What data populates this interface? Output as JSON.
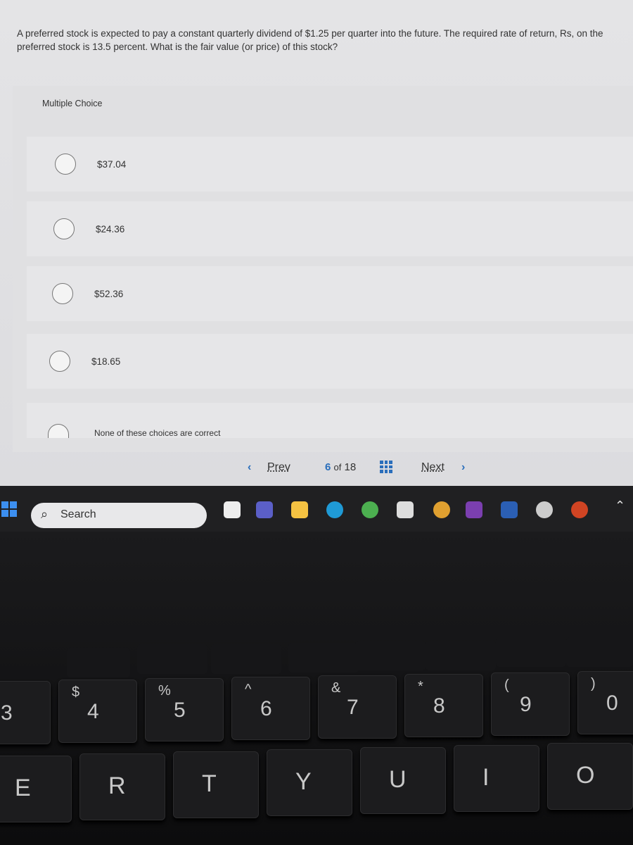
{
  "question": "A preferred stock is expected to pay a constant quarterly dividend of $1.25 per quarter into the future. The required rate of return, Rs, on the preferred stock is 13.5 percent. What is the fair value (or price) of this stock?",
  "multiple_choice_label": "Multiple Choice",
  "options": [
    "$37.04",
    "$24.36",
    "$52.36",
    "$18.65",
    "None of these choices are correct"
  ],
  "nav": {
    "prev": "Prev",
    "current": "6",
    "of": "of",
    "total": "18",
    "next": "Next"
  },
  "taskbar": {
    "search": "Search"
  },
  "accent": "#2a6ebb",
  "keyboard": {
    "num": [
      {
        "s": "",
        "m": "3"
      },
      {
        "s": "$",
        "m": "4"
      },
      {
        "s": "%",
        "m": "5"
      },
      {
        "s": "^",
        "m": "6"
      },
      {
        "s": "&",
        "m": "7"
      },
      {
        "s": "*",
        "m": "8"
      },
      {
        "s": "(",
        "m": "9"
      },
      {
        "s": ")",
        "m": "0"
      }
    ],
    "letters": [
      "E",
      "R",
      "T",
      "Y",
      "U",
      "I",
      "O"
    ]
  }
}
